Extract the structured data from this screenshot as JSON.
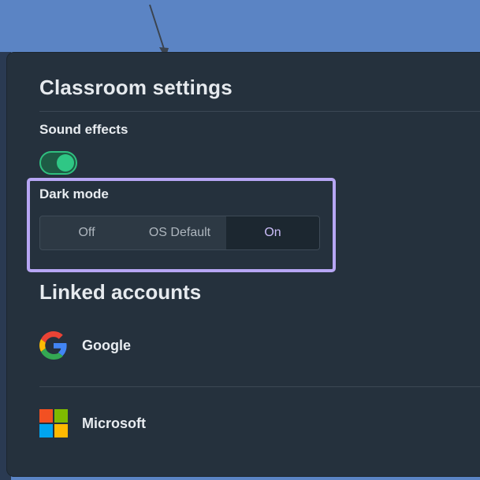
{
  "settings": {
    "title": "Classroom settings",
    "sound_effects": {
      "label": "Sound effects",
      "enabled": true
    },
    "dark_mode": {
      "label": "Dark mode",
      "options": [
        "Off",
        "OS Default",
        "On"
      ],
      "selected": "On"
    }
  },
  "linked_accounts": {
    "title": "Linked accounts",
    "items": [
      {
        "name": "Google",
        "icon": "google-icon"
      },
      {
        "name": "Microsoft",
        "icon": "microsoft-icon"
      }
    ]
  },
  "colors": {
    "panel_bg": "#25313d",
    "toggle_on": "#2fc785",
    "highlight_border": "#b7a6f4",
    "selected_text": "#cbbdf8",
    "page_bg": "#5b84c4"
  }
}
